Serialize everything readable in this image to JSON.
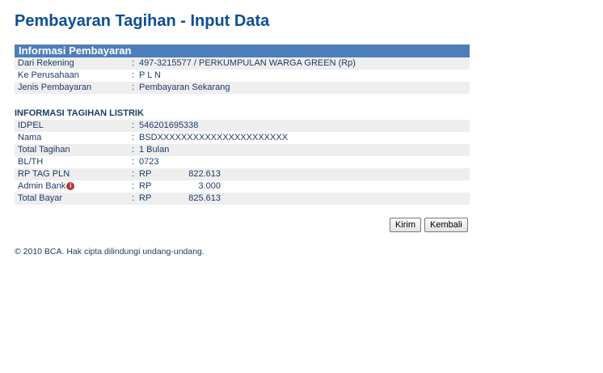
{
  "page": {
    "title": "Pembayaran Tagihan - Input Data"
  },
  "informasi_pembayaran": {
    "header": "Informasi Pembayaran",
    "rows": [
      {
        "label": "Dari Rekening",
        "value": "497-3215577 / PERKUMPULAN WARGA GREEN (Rp)"
      },
      {
        "label": "Ke Perusahaan",
        "value": "P L N"
      },
      {
        "label": "Jenis Pembayaran",
        "value": "Pembayaran Sekarang"
      }
    ]
  },
  "tagihan": {
    "title": "INFORMASI TAGIHAN LISTRIK",
    "rows": [
      {
        "label": "IDPEL",
        "value": "546201695338"
      },
      {
        "label": "Nama",
        "value": "BSDXXXXXXXXXXXXXXXXXXXXXX"
      },
      {
        "label": "Total Tagihan",
        "value": "1 Bulan"
      },
      {
        "label": "BL/TH",
        "value": "0723"
      },
      {
        "label": "RP TAG PLN",
        "currency": "RP",
        "amount": "822.613"
      },
      {
        "label": "Admin Bank",
        "currency": "RP",
        "amount": "3.000"
      },
      {
        "label": "Total Bayar",
        "currency": "RP",
        "amount": "825.613"
      }
    ]
  },
  "colon": ":",
  "info_icon_glyph": "i",
  "buttons": {
    "kirim": "Kirim",
    "kembali": "Kembali"
  },
  "footer": {
    "copyright": "©  2010 BCA. Hak cipta dilindungi undang-undang."
  },
  "colors": {
    "title": "#0b4f96",
    "header_bg": "#4d7fbb",
    "row_alt": "#eeeeee",
    "text": "#1d3c6a",
    "info_icon": "#b8322d"
  }
}
